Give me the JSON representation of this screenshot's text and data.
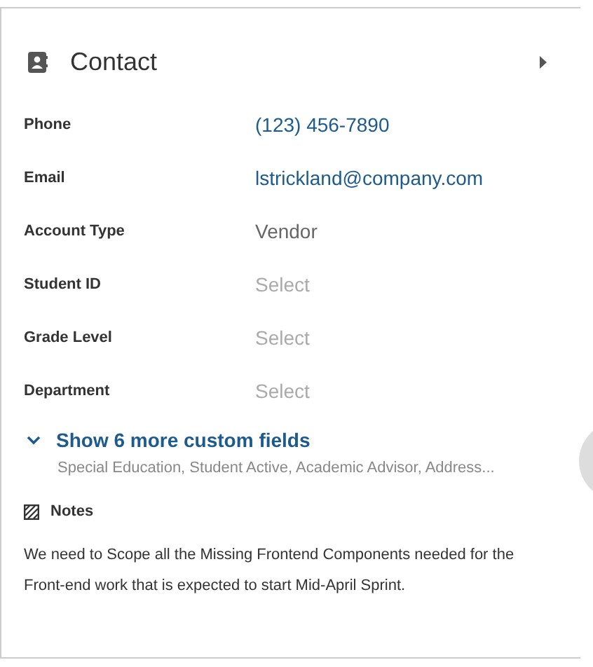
{
  "section": {
    "title": "Contact",
    "expanded": false
  },
  "fields": [
    {
      "label": "Phone",
      "value": "(123) 456-7890",
      "kind": "link"
    },
    {
      "label": "Email",
      "value": "lstrickland@company.com",
      "kind": "link"
    },
    {
      "label": "Account Type",
      "value": "Vendor",
      "kind": "text"
    },
    {
      "label": "Student ID",
      "placeholder": "Select",
      "kind": "select"
    },
    {
      "label": "Grade Level",
      "placeholder": "Select",
      "kind": "select"
    },
    {
      "label": "Department",
      "placeholder": "Select",
      "kind": "select"
    }
  ],
  "more_fields": {
    "label": "Show 6 more custom fields",
    "summary": "Special Education, Student Active, Academic Advisor, Address..."
  },
  "notes": {
    "title": "Notes",
    "text": "We need to Scope all the Missing Frontend Components needed for the Front-end work that is expected to start Mid-April Sprint."
  }
}
